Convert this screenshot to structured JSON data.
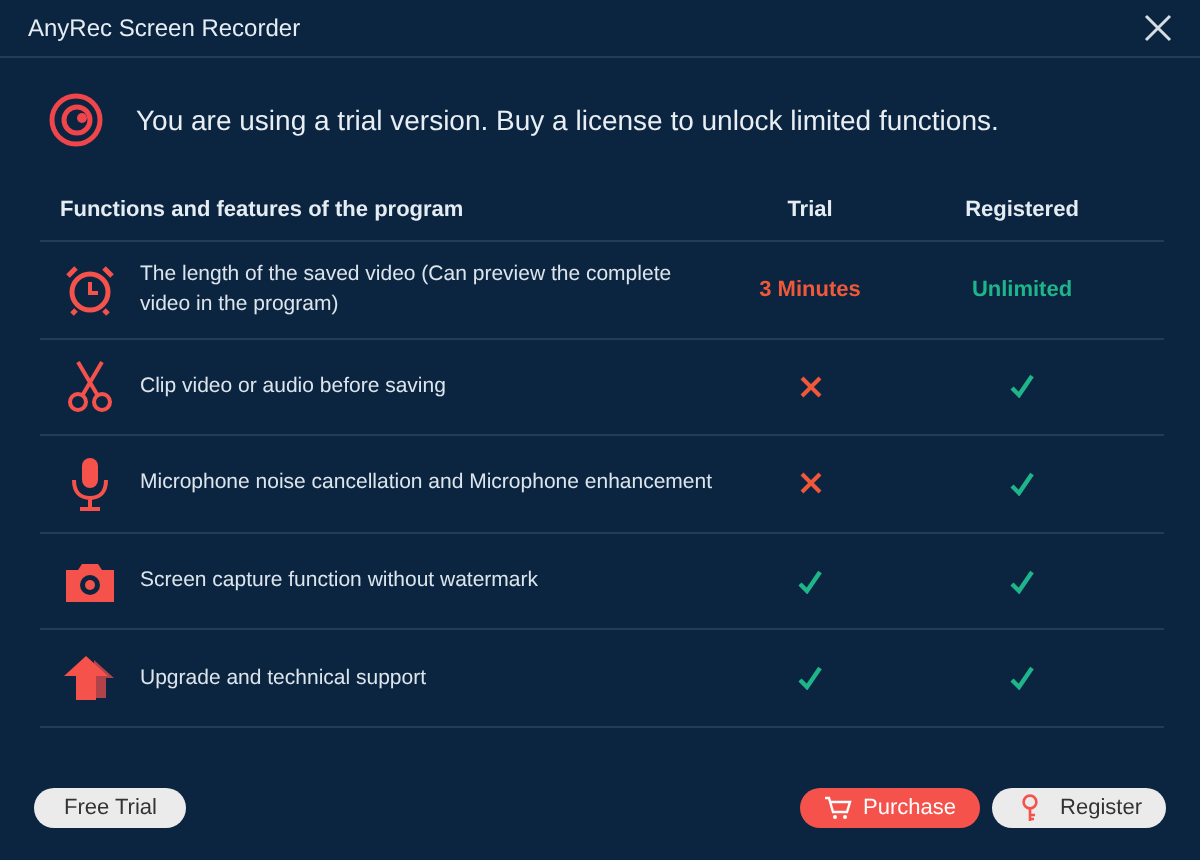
{
  "window": {
    "title": "AnyRec Screen Recorder"
  },
  "banner": {
    "message": "You are using a trial version. Buy a license to unlock limited functions."
  },
  "table": {
    "columns": [
      "Functions and features of the program",
      "Trial",
      "Registered"
    ],
    "rows": [
      {
        "feature": "The length of the saved video (Can preview the complete video in the program)",
        "trial": {
          "kind": "text",
          "text": "3 Minutes"
        },
        "registered": {
          "kind": "text",
          "text": "Unlimited"
        }
      },
      {
        "feature": "Clip video or audio before saving",
        "trial": {
          "kind": "cross"
        },
        "registered": {
          "kind": "check"
        }
      },
      {
        "feature": "Microphone noise cancellation and Microphone enhancement",
        "trial": {
          "kind": "cross"
        },
        "registered": {
          "kind": "check"
        }
      },
      {
        "feature": "Screen capture function without watermark",
        "trial": {
          "kind": "check"
        },
        "registered": {
          "kind": "check"
        }
      },
      {
        "feature": "Upgrade and technical support",
        "trial": {
          "kind": "check"
        },
        "registered": {
          "kind": "check"
        }
      }
    ]
  },
  "buttons": {
    "free_trial": "Free Trial",
    "purchase": "Purchase",
    "register": "Register"
  }
}
